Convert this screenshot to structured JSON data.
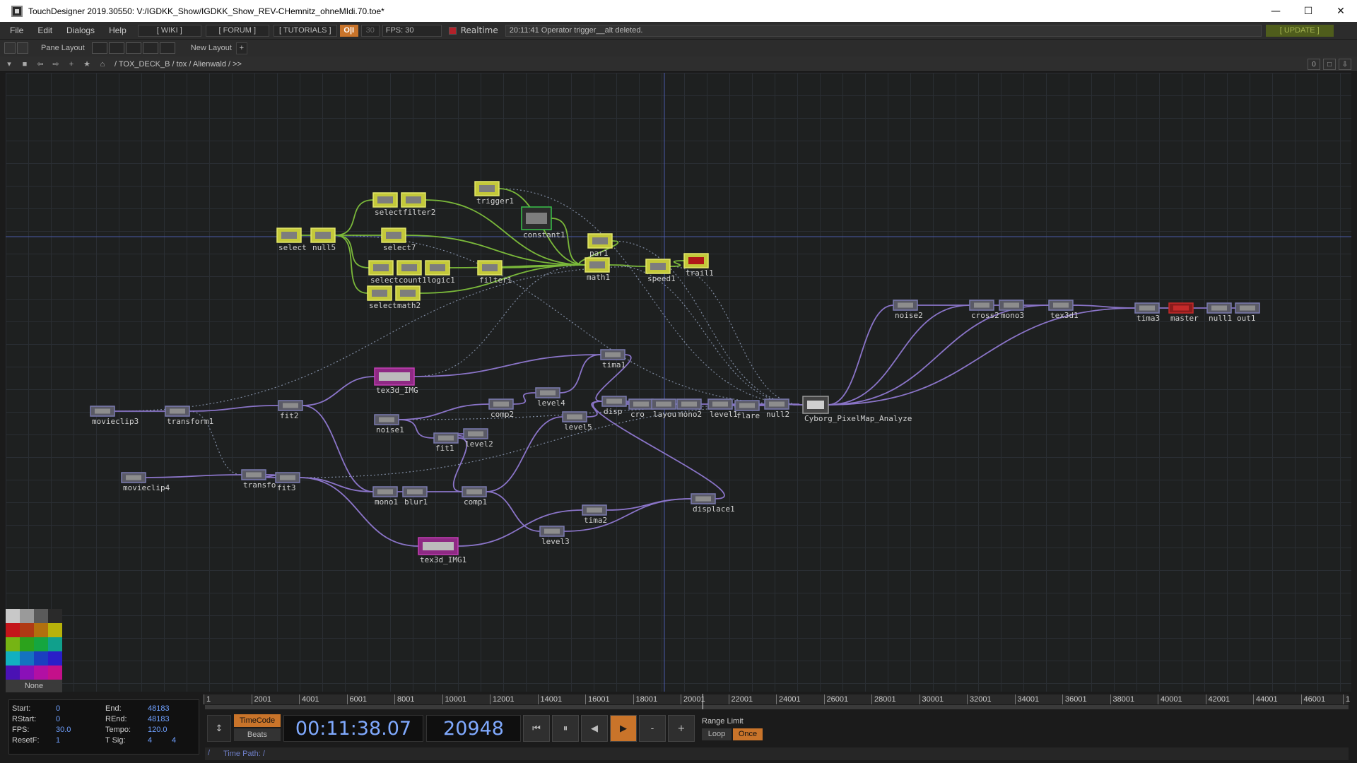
{
  "window": {
    "title": "TouchDesigner 2019.30550: V:/IGDKK_Show/IGDKK_Show_REV-CHemnitz_ohneMIdi.70.toe*",
    "minimize": "—",
    "maximize": "☐",
    "close": "✕"
  },
  "menubar": {
    "items": [
      "File",
      "Edit",
      "Dialogs",
      "Help"
    ],
    "wiki": "[ WIKI ]",
    "forum": "[ FORUM ]",
    "tutorials": "[ TUTORIALS ]",
    "oi": "O|I",
    "fps_cook": "30",
    "fps_label": "FPS:  30",
    "realtime": "Realtime",
    "status": "20:11:41 Operator trigger__alt deleted.",
    "update": "[ UPDATE ]"
  },
  "panebar": {
    "pane_layout": "Pane Layout",
    "new_layout": "New Layout",
    "add": "+"
  },
  "pathbar": {
    "path": "/ TOX_DECK_B / tox / Alienwald / >>",
    "right_value": "0"
  },
  "nodes": [
    {
      "id": "selectA",
      "label": "select",
      "color": "chop"
    },
    {
      "id": "null5",
      "label": "null5",
      "color": "chop"
    },
    {
      "id": "selectB",
      "label": "select",
      "color": "chop"
    },
    {
      "id": "filter2",
      "label": "filter2",
      "color": "chop"
    },
    {
      "id": "select7",
      "label": "select7",
      "color": "chop"
    },
    {
      "id": "selectC",
      "label": "select",
      "color": "chop"
    },
    {
      "id": "count1",
      "label": "count1",
      "color": "chop"
    },
    {
      "id": "logic1",
      "label": "logic1",
      "color": "chop"
    },
    {
      "id": "filter1",
      "label": "filter1",
      "color": "chop"
    },
    {
      "id": "selectD",
      "label": "select",
      "color": "chop"
    },
    {
      "id": "math2",
      "label": "math2",
      "color": "chop"
    },
    {
      "id": "trigger1",
      "label": "trigger1",
      "color": "chop"
    },
    {
      "id": "constant1",
      "label": "constant1",
      "color": "chopgreen"
    },
    {
      "id": "par1",
      "label": "par1",
      "color": "chop"
    },
    {
      "id": "math1",
      "label": "math1",
      "color": "chop"
    },
    {
      "id": "speed1",
      "label": "speed1",
      "color": "chop"
    },
    {
      "id": "trail1",
      "label": "trail1",
      "color": "chopred"
    },
    {
      "id": "tex3d_IMG",
      "label": "tex3d_IMG",
      "color": "top3d"
    },
    {
      "id": "tima1",
      "label": "tima1",
      "color": "top"
    },
    {
      "id": "movieclip3",
      "label": "movieclip3",
      "color": "top"
    },
    {
      "id": "transform1",
      "label": "transform1",
      "color": "top"
    },
    {
      "id": "fit2",
      "label": "fit2",
      "color": "top"
    },
    {
      "id": "noise1",
      "label": "noise1",
      "color": "top"
    },
    {
      "id": "comp2",
      "label": "comp2",
      "color": "top"
    },
    {
      "id": "level4",
      "label": "level4",
      "color": "top"
    },
    {
      "id": "level5",
      "label": "level5",
      "color": "top"
    },
    {
      "id": "fit1",
      "label": "fit1",
      "color": "top"
    },
    {
      "id": "level2",
      "label": "level2",
      "color": "top"
    },
    {
      "id": "displace",
      "label": "disp",
      "color": "top"
    },
    {
      "id": "crop",
      "label": "cro",
      "color": "top"
    },
    {
      "id": "layout",
      "label": "layou",
      "color": "top"
    },
    {
      "id": "mono2",
      "label": "mono2",
      "color": "top"
    },
    {
      "id": "level1",
      "label": "level1",
      "color": "top"
    },
    {
      "id": "flare",
      "label": "flare",
      "color": "top"
    },
    {
      "id": "null2",
      "label": "null2",
      "color": "top"
    },
    {
      "id": "cyborg",
      "label": "Cyborg_PixelMap_Analyze",
      "color": "comp"
    },
    {
      "id": "movieclip4",
      "label": "movieclip4",
      "color": "top"
    },
    {
      "id": "transform2",
      "label": "transfo",
      "color": "top"
    },
    {
      "id": "fit3",
      "label": "fit3",
      "color": "top"
    },
    {
      "id": "mono1",
      "label": "mono1",
      "color": "top"
    },
    {
      "id": "blur1",
      "label": "blur1",
      "color": "top"
    },
    {
      "id": "comp1",
      "label": "comp1",
      "color": "top"
    },
    {
      "id": "tima2",
      "label": "tima2",
      "color": "top"
    },
    {
      "id": "displace1",
      "label": "displace1",
      "color": "top"
    },
    {
      "id": "level3",
      "label": "level3",
      "color": "top"
    },
    {
      "id": "tex3d_IMG1",
      "label": "tex3d_IMG1",
      "color": "top3d"
    },
    {
      "id": "noise2",
      "label": "noise2",
      "color": "top"
    },
    {
      "id": "cross2",
      "label": "cross2",
      "color": "top"
    },
    {
      "id": "mono3",
      "label": "mono3",
      "color": "top"
    },
    {
      "id": "tex3d1",
      "label": "tex3d1",
      "color": "top"
    },
    {
      "id": "tima3",
      "label": "tima3",
      "color": "top"
    },
    {
      "id": "master",
      "label": "master",
      "color": "topred"
    },
    {
      "id": "null1",
      "label": "null1",
      "color": "top"
    },
    {
      "id": "out1",
      "label": "out1",
      "color": "top"
    }
  ],
  "palette": {
    "colors": [
      "#c8c8c8",
      "#9a9a9a",
      "#5a5a5a",
      "#2a2a2a",
      "#c4151a",
      "#b03a14",
      "#b2700e",
      "#b7b20a",
      "#76b414",
      "#2ca21c",
      "#15a640",
      "#10a08c",
      "#12b0c0",
      "#1473c0",
      "#1a3fc0",
      "#2a1ec8",
      "#4a12b4",
      "#8a10b8",
      "#b20fa4",
      "#c4108a"
    ],
    "none": "None"
  },
  "timeline": {
    "start_label": "Start:",
    "start": "0",
    "end_label": "End:",
    "end": "48183",
    "rstart_label": "RStart:",
    "rstart": "0",
    "rend_label": "REnd:",
    "rend": "48183",
    "fps_label": "FPS:",
    "fps": "30.0",
    "tempo_label": "Tempo:",
    "tempo": "120.0",
    "resetf_label": "ResetF:",
    "resetf": "1",
    "tsig_label": "T Sig:",
    "tsig_a": "4",
    "tsig_b": "4",
    "ticks": [
      "1",
      "2001",
      "4001",
      "6001",
      "8001",
      "10001",
      "12001",
      "14001",
      "16001",
      "18001",
      "20001",
      "22001",
      "24001",
      "26001",
      "28001",
      "30001",
      "32001",
      "34001",
      "36001",
      "38001",
      "40001",
      "42001",
      "44001",
      "46001",
      "1"
    ],
    "timecode": "TimeCode",
    "beats": "Beats",
    "time": "00:11:38.07",
    "frame": "20948",
    "btn_start": "⏮",
    "btn_pause": "⏸",
    "btn_back": "◀",
    "btn_play": "▶",
    "btn_minus": "-",
    "btn_plus": "+",
    "range_limit": "Range Limit",
    "loop": "Loop",
    "once": "Once",
    "time_path": "Time Path: /",
    "slash": "/"
  }
}
